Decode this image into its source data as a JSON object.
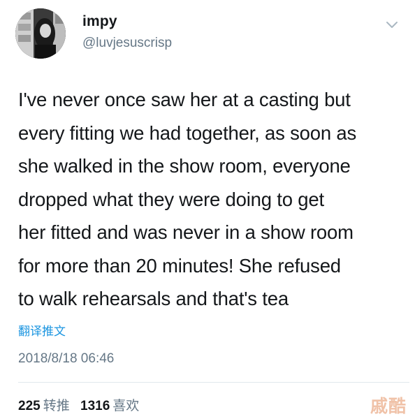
{
  "user": {
    "display_name": "impy",
    "handle": "@luvjesuscrisp"
  },
  "tweet": {
    "lines": [
      "I've never once saw her at a casting but",
      "every fitting we had together, as soon as",
      "she walked in the show room, everyone",
      "dropped what they were doing to get",
      "her fitted and was never in a show room",
      "for more than 20 minutes! She refused",
      "to walk rehearsals and that's tea"
    ],
    "translate_label": "翻译推文",
    "timestamp": "2018/8/18 06:46"
  },
  "stats": {
    "retweets": "225",
    "retweets_label": "转推",
    "likes": "1316",
    "likes_label": "喜欢"
  },
  "watermark": "戚酷",
  "icons": {
    "menu": "chevron-down-icon",
    "profile": "avatar"
  },
  "colors": {
    "link": "#1b95e0",
    "muted": "#657786",
    "text": "#14171a"
  }
}
